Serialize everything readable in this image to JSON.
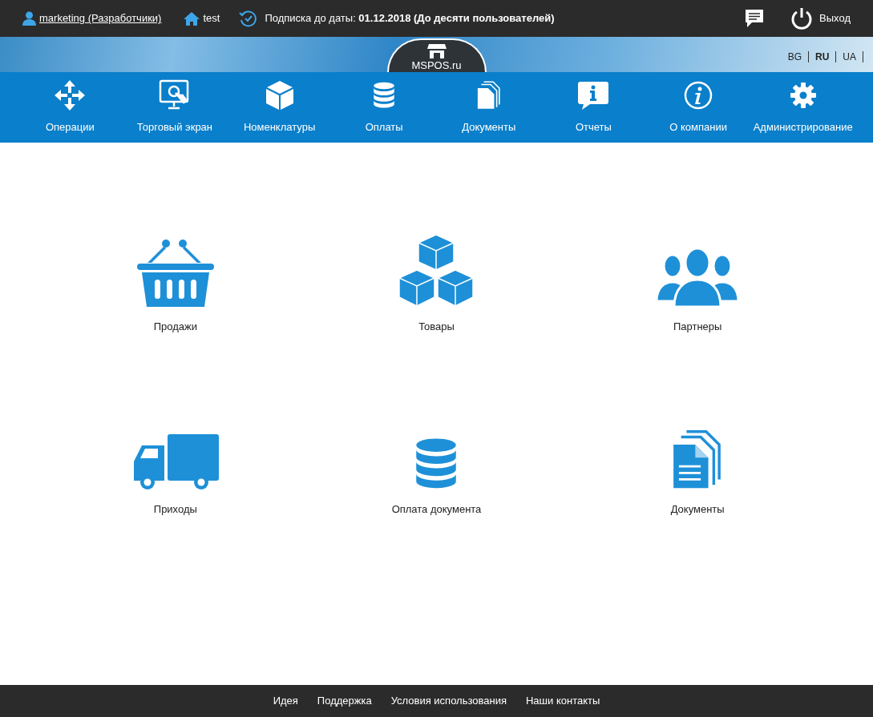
{
  "top_bar": {
    "user": "marketing (Разработчики)",
    "store": "test",
    "subscription": "Подписка до даты: **01.12.2018 (До десяти пользователей)**",
    "logout": "Выход"
  },
  "banner": {
    "logo": "MSPOS.ru",
    "languages": [
      {
        "label": "BG",
        "selected": false
      },
      {
        "label": "RU",
        "selected": true
      },
      {
        "label": "UA",
        "selected": false
      }
    ]
  },
  "nav": [
    {
      "label": "Операции"
    },
    {
      "label": "Торговый экран"
    },
    {
      "label": "Номенклатуры"
    },
    {
      "label": "Оплаты"
    },
    {
      "label": "Документы"
    },
    {
      "label": "Отчеты"
    },
    {
      "label": "О компании"
    },
    {
      "label": "Администрирование"
    }
  ],
  "tiles": [
    {
      "label": "Продажи"
    },
    {
      "label": "Товары"
    },
    {
      "label": "Партнеры"
    },
    {
      "label": "Приходы"
    },
    {
      "label": "Оплата документа"
    },
    {
      "label": "Документы"
    }
  ],
  "footer": [
    "Идея",
    "Поддержка",
    "Условия использования",
    "Наши контакты"
  ]
}
